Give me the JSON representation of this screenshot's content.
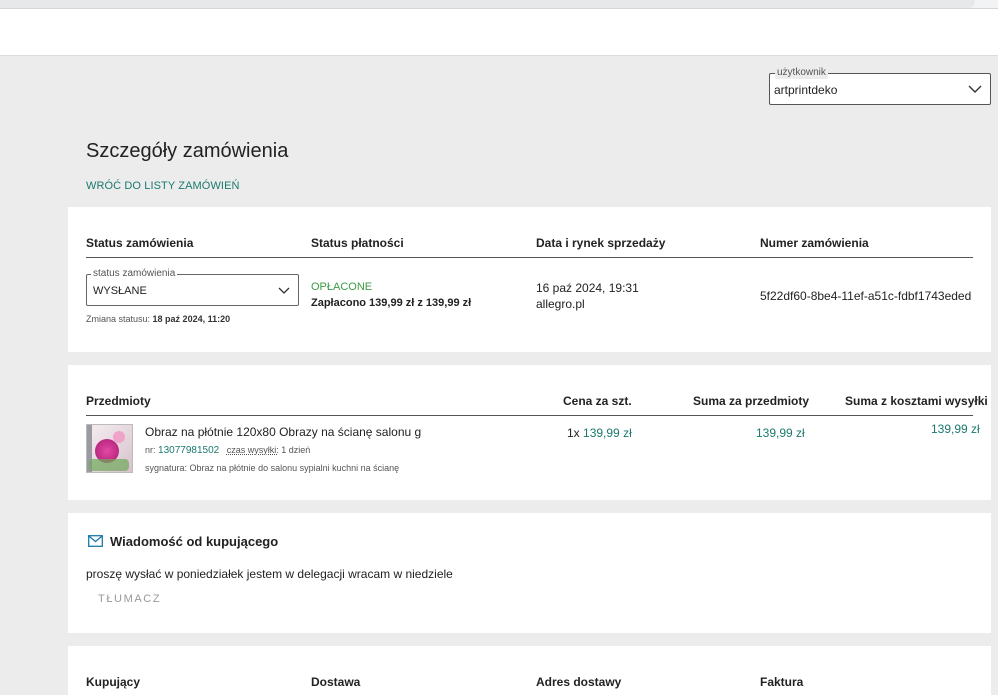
{
  "user_select": {
    "legend": "użytkownik",
    "value": "artprintdeko"
  },
  "page": {
    "title": "Szczegóły zamówienia",
    "back_link": "WRÓĆ DO LISTY ZAMÓWIEŃ"
  },
  "order_card": {
    "headers": {
      "order_status": "Status zamówienia",
      "payment_status": "Status płatności",
      "date_market": "Data i rynek sprzedaży",
      "order_number": "Numer zamówienia"
    },
    "status_select": {
      "legend": "status zamówienia",
      "value": "WYSŁANE"
    },
    "status_change_label": "Zmiana statusu:",
    "status_change_date": "18 paź 2024, 11:20",
    "payment_state": "OPŁACONE",
    "payment_detail": "Zapłacono 139,99 zł z 139,99 zł",
    "sale_date": "16 paź 2024, 19:31",
    "market": "allegro.pl",
    "order_number": "5f22df60-8be4-11ef-a51c-fdbf1743eded"
  },
  "items_card": {
    "headers": {
      "items": "Przedmioty",
      "unit_price": "Cena za szt.",
      "items_total": "Suma za przedmioty",
      "total_with_shipping": "Suma z kosztami wysyłki"
    },
    "item": {
      "title": "Obraz na płótnie 120x80 Obrazy na ścianę salonu g",
      "nr_label": "nr:",
      "nr": "13077981502",
      "ship_label": "czas wysyłki:",
      "ship_time": "1 dzień",
      "signature": "sygnatura: Obraz na płótnie do salonu sypialni kuchni na ścianę",
      "qty_price_prefix": "1x",
      "unit_price": "139,99 zł",
      "items_total": "139,99 zł",
      "total_with_shipping": "139,99 zł"
    }
  },
  "message_card": {
    "title": "Wiadomość od kupującego",
    "text": "proszę wysłać w poniedziałek jestem w delegacji wracam w niedziele",
    "translate": "TŁUMACZ",
    "icon": "mail-icon"
  },
  "buyer_card": {
    "headers": {
      "buyer": "Kupujący",
      "delivery": "Dostawa",
      "address": "Adres dostawy",
      "invoice": "Faktura"
    }
  },
  "colors": {
    "accent_teal": "#1a7a6e",
    "paid_green": "#3a9a44",
    "background": "#ececec"
  }
}
